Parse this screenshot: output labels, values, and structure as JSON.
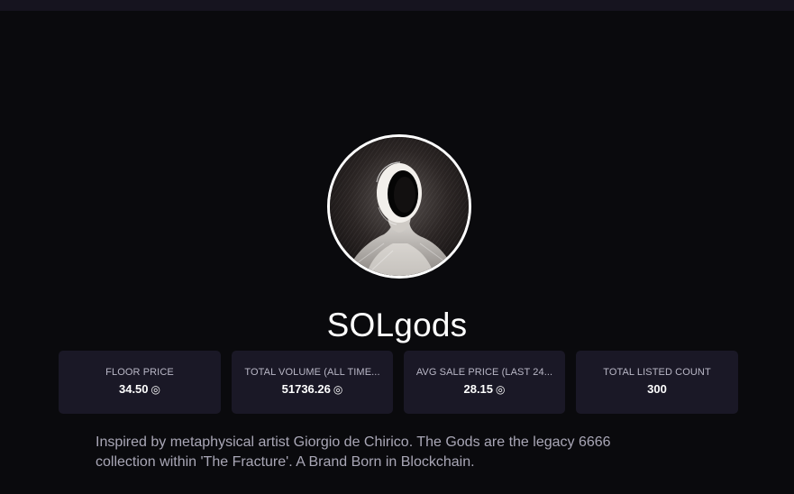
{
  "collection": {
    "name": "SOLgods",
    "avatar_alt": "SOLgods collection avatar",
    "description": "Inspired by metaphysical artist Giorgio de Chirico. The Gods are the legacy 6666 collection within 'The Fracture'. A Brand Born in Blockchain."
  },
  "stats": [
    {
      "label": "FLOOR PRICE",
      "value": "34.50",
      "currency_icon": "◎"
    },
    {
      "label": "TOTAL VOLUME (ALL TIME...",
      "value": "51736.26",
      "currency_icon": "◎"
    },
    {
      "label": "AVG SALE PRICE (LAST 24...",
      "value": "28.15",
      "currency_icon": "◎"
    },
    {
      "label": "TOTAL LISTED COUNT",
      "value": "300",
      "currency_icon": ""
    }
  ],
  "colors": {
    "background": "#0a0a0d",
    "card": "#1a1826",
    "muted_text": "#a9a7b6"
  }
}
